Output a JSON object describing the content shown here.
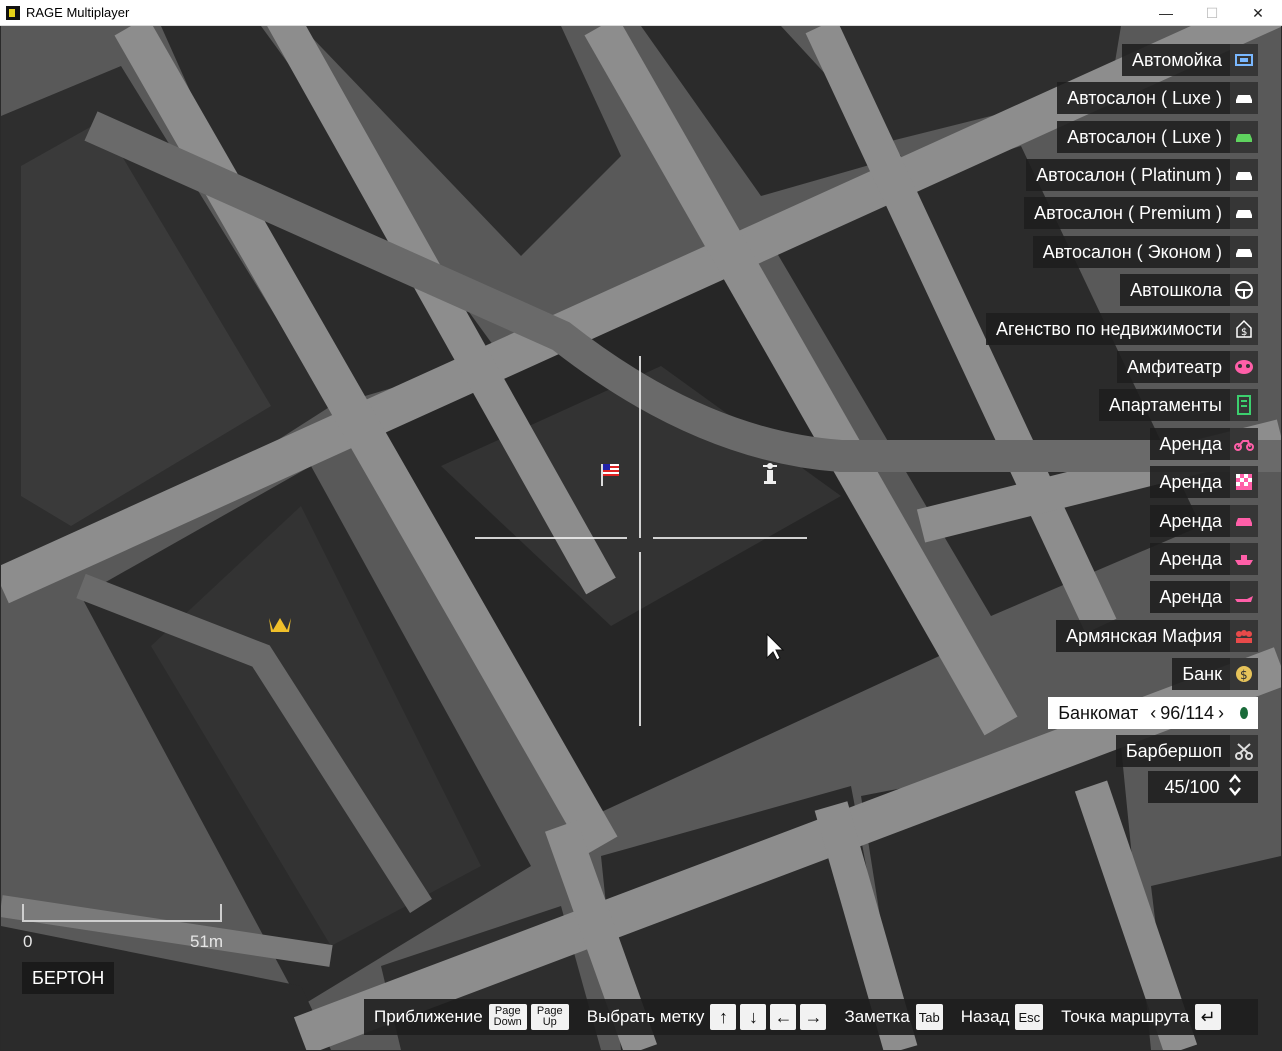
{
  "window": {
    "title": "RAGE Multiplayer",
    "minimize": "—",
    "maximize": "☐",
    "close": "✕"
  },
  "legend": [
    {
      "label": "Автомойка",
      "icon": "car-wash-icon",
      "color": "#7ab8ff"
    },
    {
      "label": "Автосалон ( Luxe )",
      "icon": "car-icon",
      "color": "#ffffff"
    },
    {
      "label": "Автосалон ( Luxe )",
      "icon": "car-icon",
      "color": "#5fd35f"
    },
    {
      "label": "Автосалон ( Platinum )",
      "icon": "car-icon",
      "color": "#ffffff"
    },
    {
      "label": "Автосалон ( Premium )",
      "icon": "car-icon",
      "color": "#ffffff"
    },
    {
      "label": "Автосалон ( Эконом )",
      "icon": "car-icon",
      "color": "#ffffff"
    },
    {
      "label": "Автошкола",
      "icon": "steering-wheel-icon",
      "color": "#ffffff"
    },
    {
      "label": "Агенство по недвижимости",
      "icon": "house-dollar-icon",
      "color": "#ffffff"
    },
    {
      "label": "Амфитеатр",
      "icon": "mask-icon",
      "color": "#ff5fa8"
    },
    {
      "label": "Апартаменты",
      "icon": "building-icon",
      "color": "#3ccf6e"
    },
    {
      "label": "Аренда",
      "icon": "motorbike-icon",
      "color": "#ff5fa8"
    },
    {
      "label": "Аренда",
      "icon": "checkered-flag-icon",
      "color": "#ff5fa8"
    },
    {
      "label": "Аренда",
      "icon": "car-icon",
      "color": "#ff5fa8"
    },
    {
      "label": "Аренда",
      "icon": "boat-icon",
      "color": "#ff5fa8"
    },
    {
      "label": "Аренда",
      "icon": "jetski-icon",
      "color": "#ff5fa8"
    },
    {
      "label": "Армянская Мафия",
      "icon": "group-icon",
      "color": "#e84a4a"
    },
    {
      "label": "Банк",
      "icon": "dollar-coin-icon",
      "color": "#e6c35a"
    },
    {
      "label": "Банкомат",
      "icon": "atm-icon",
      "color": "#3ccf6e",
      "counter": "96/114",
      "selected": true
    },
    {
      "label": "Барбершоп",
      "icon": "scissors-icon",
      "color": "#ffffff"
    }
  ],
  "pager": {
    "value": "45/100"
  },
  "scale": {
    "start": "0",
    "end": "51m"
  },
  "area_name": "БЕРТОН",
  "helpbar": {
    "zoom_label": "Приближение",
    "page_down": [
      "Page",
      "Down"
    ],
    "page_up": [
      "Page",
      "Up"
    ],
    "select_label": "Выбрать метку",
    "arrow_up": "↑",
    "arrow_down": "↓",
    "arrow_left": "←",
    "arrow_right": "→",
    "note_label": "Заметка",
    "tab_key": "Tab",
    "back_label": "Назад",
    "esc_key": "Esc",
    "waypoint_label": "Точка маршрута",
    "enter_key": "↵"
  },
  "map_markers": [
    {
      "icon": "american-flag-icon"
    },
    {
      "icon": "person-statue-icon"
    },
    {
      "icon": "crown-icon",
      "color": "#f0c02a"
    }
  ],
  "colors": {
    "road": "#8d8d8d",
    "road_dark": "#6a6a6a",
    "block": "#2b2b2b",
    "ground": "#5a5a5a"
  }
}
